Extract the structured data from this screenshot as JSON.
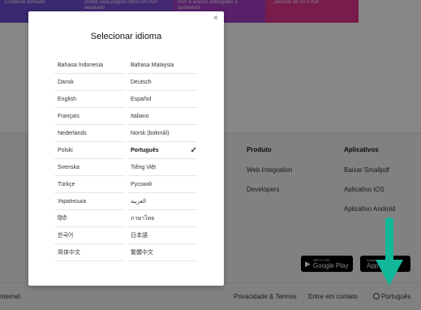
{
  "banners": [
    {
      "text": "Conteúdo ilimitado",
      "color": "#6a4fd3"
    },
    {
      "text": "Dividir cada página como um PDF separado",
      "color": "#7c4cd6"
    },
    {
      "text": "PDF e acesso antecipado à assinatura",
      "color": "#a53ec6"
    },
    {
      "text": "…período de 30 s PDF",
      "color": "#e0368f"
    }
  ],
  "footer": {
    "product": {
      "heading": "Produto",
      "links": [
        "Web Integration",
        "Developers"
      ]
    },
    "apps": {
      "heading": "Aplicativos",
      "links": [
        "Baixar Smallpdf",
        "Aplicativo iOS",
        "Aplicativo Android"
      ]
    },
    "google_play": {
      "small": "GET IT ON",
      "big": "Google Play"
    },
    "app_store": {
      "small": "Download on the",
      "big": "App Store"
    },
    "bottom_left": "nternet.",
    "privacy": "Privacidade & Termos",
    "contact": "Entre em contato",
    "language": "Português"
  },
  "modal": {
    "title": "Selecionar idioma",
    "close": "×",
    "left_languages": [
      "Bahasa Indonesia",
      "Dansk",
      "English",
      "Français",
      "Nederlands",
      "Polski",
      "Svenska",
      "Türkçe",
      "Українська",
      "हिंदी",
      "한국어",
      "简体中文"
    ],
    "right_languages": [
      "Bahasa Malaysia",
      "Deutsch",
      "Español",
      "Italiano",
      "Norsk (bokmål)",
      "Português",
      "Tiếng Việt",
      "Русский",
      "العربية",
      "ภาษาไทย",
      "日本語",
      "繁體中文"
    ],
    "selected": "Português",
    "check_icon": "✓"
  },
  "accent_arrow_color": "#12b89a",
  "overlay_color": "rgba(0,0,0,0.47)"
}
